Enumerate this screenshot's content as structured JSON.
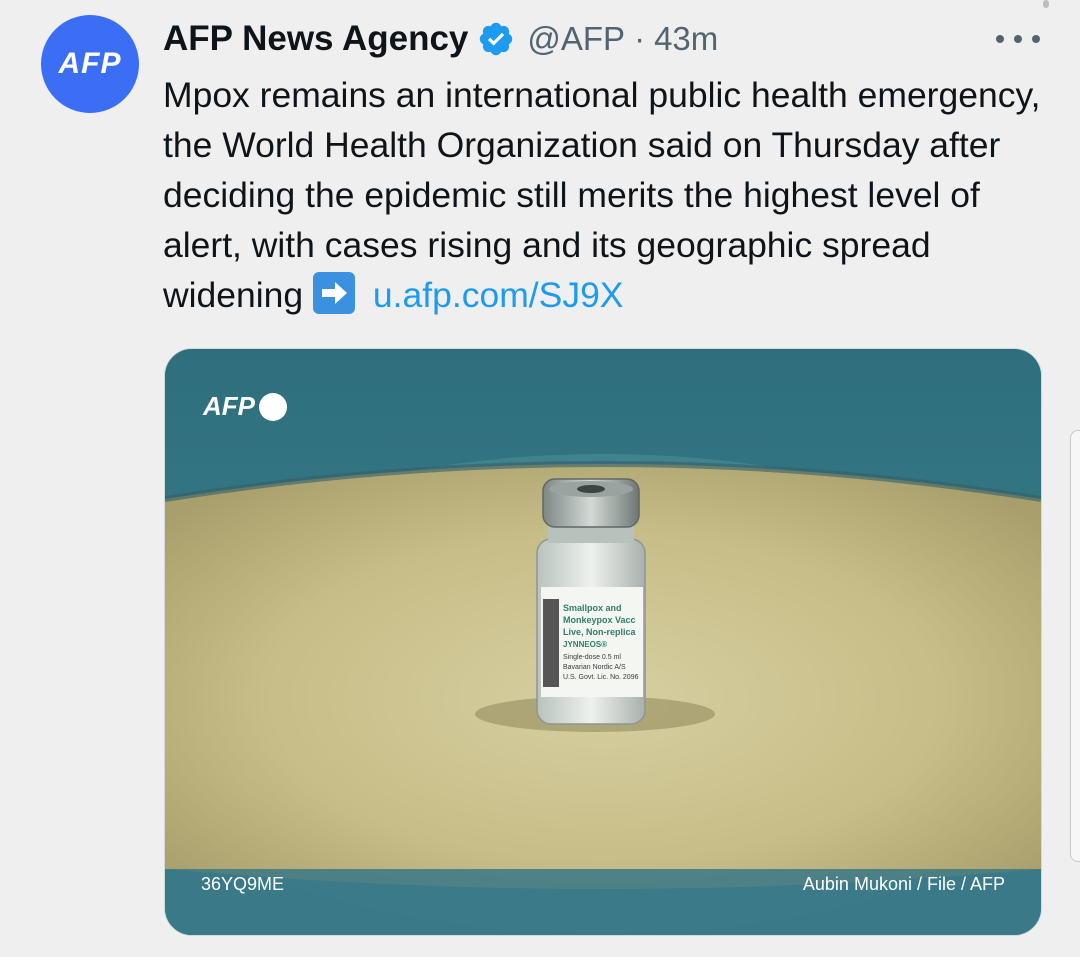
{
  "author": {
    "avatar_text": "AFP",
    "name": "AFP News Agency",
    "handle": "@AFP",
    "separator": "·",
    "time": "43m",
    "verified_icon": "verified-badge-icon"
  },
  "tweet": {
    "text": "Mpox remains an international public health emergency, the World Health Organization said on Thursday after deciding the epidemic still merits the highest level of alert, with cases rising and its geographic spread widening",
    "arrow_icon": "right-arrow-emoji-icon",
    "link": "u.afp.com/SJ9X"
  },
  "media": {
    "watermark": "AFP",
    "code": "36YQ9ME",
    "credit": "Aubin Mukoni / File / AFP",
    "vial_label_lines": [
      "Smallpox and",
      "Monkeypox Vacc",
      "Live, Non-replica",
      "JYNNEOS®",
      "Single-dose 0.5 ml",
      "Bavarian Nordic A/S",
      "U.S. Govt. Lic. No. 2096"
    ]
  },
  "colors": {
    "background": "#efefef",
    "avatar": "#3b6ef5",
    "link": "#1d9bf0",
    "verified": "#1d9bf0",
    "tray": "#3f7f8a",
    "sand": "#c9c08e"
  }
}
